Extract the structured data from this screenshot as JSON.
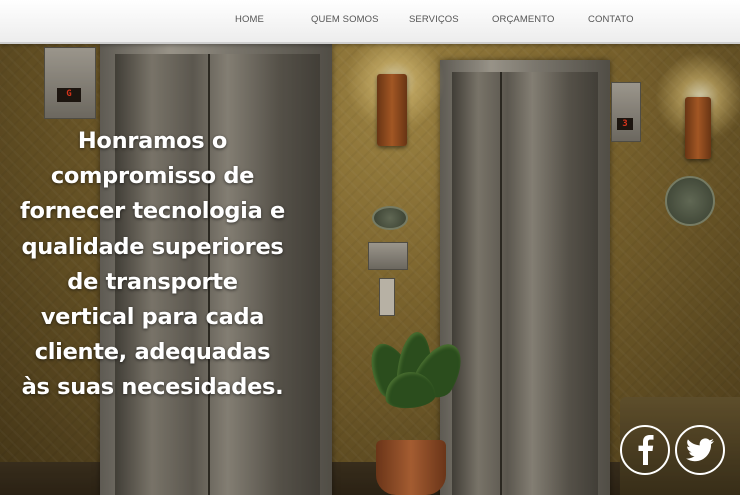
{
  "nav": {
    "items": [
      {
        "label": "HOME"
      },
      {
        "label": "QUEM SOMOS"
      },
      {
        "label": "SERVIÇOS"
      },
      {
        "label": "ORÇAMENTO"
      },
      {
        "label": "CONTATO"
      }
    ]
  },
  "hero": {
    "headline": "Honramos o compromisso de fornecer tecnologia e qualidade superiores de transporte vertical para cada cliente, adequadas às suas necesidades.",
    "indicators": [
      "G",
      "3"
    ]
  },
  "social": {
    "facebook_icon": "facebook-icon",
    "twitter_icon": "twitter-icon",
    "color": "#ffffff"
  },
  "colors": {
    "nav_background": "#f2f2f2",
    "nav_text": "#555555",
    "headline_text": "#ffffff"
  }
}
